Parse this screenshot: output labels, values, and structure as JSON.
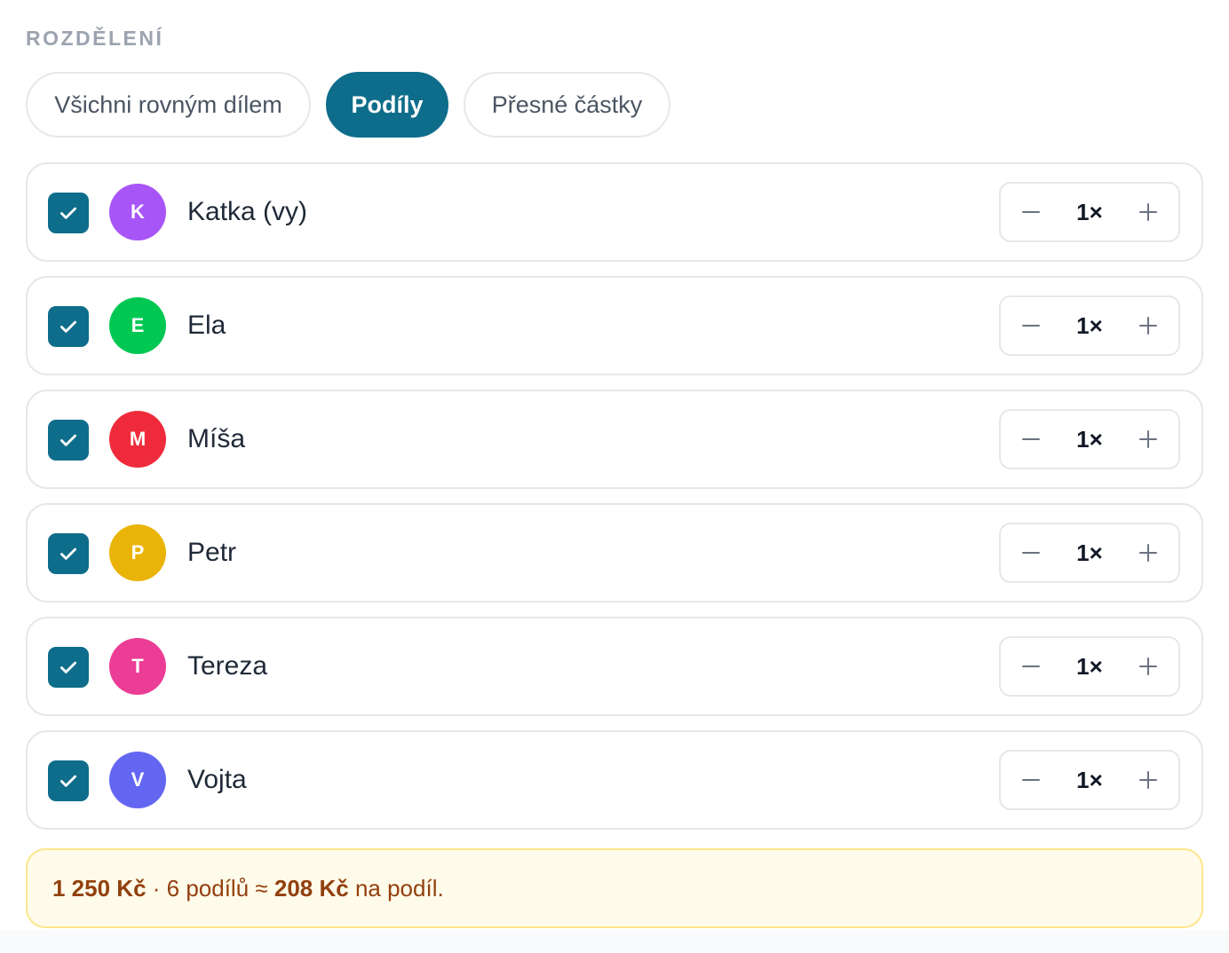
{
  "section_label": "ROZDĚLENÍ",
  "tabs": [
    {
      "label": "Všichni rovným dílem",
      "active": false
    },
    {
      "label": "Podíly",
      "active": true
    },
    {
      "label": "Přesné částky",
      "active": false
    }
  ],
  "icons": {
    "checkbox": "check-icon",
    "decrement": "minus-icon",
    "increment": "plus-icon"
  },
  "colors": {
    "accent": "#0e6d8a",
    "summary_bg": "#fffbea",
    "summary_border": "#fde68a",
    "summary_text": "#92400e"
  },
  "participants": [
    {
      "initial": "K",
      "name": "Katka (vy)",
      "color": "#a855f7",
      "checked": true,
      "share": "1×"
    },
    {
      "initial": "E",
      "name": "Ela",
      "color": "#00c853",
      "checked": true,
      "share": "1×"
    },
    {
      "initial": "M",
      "name": "Míša",
      "color": "#ef2b3b",
      "checked": true,
      "share": "1×"
    },
    {
      "initial": "P",
      "name": "Petr",
      "color": "#eab308",
      "checked": true,
      "share": "1×"
    },
    {
      "initial": "T",
      "name": "Tereza",
      "color": "#ec3d96",
      "checked": true,
      "share": "1×"
    },
    {
      "initial": "V",
      "name": "Vojta",
      "color": "#6366f1",
      "checked": true,
      "share": "1×"
    }
  ],
  "summary": {
    "total": "1 250 Kč",
    "sep1": " · 6 podílů ≈ ",
    "per_share": "208 Kč",
    "suffix": " na podíl."
  }
}
